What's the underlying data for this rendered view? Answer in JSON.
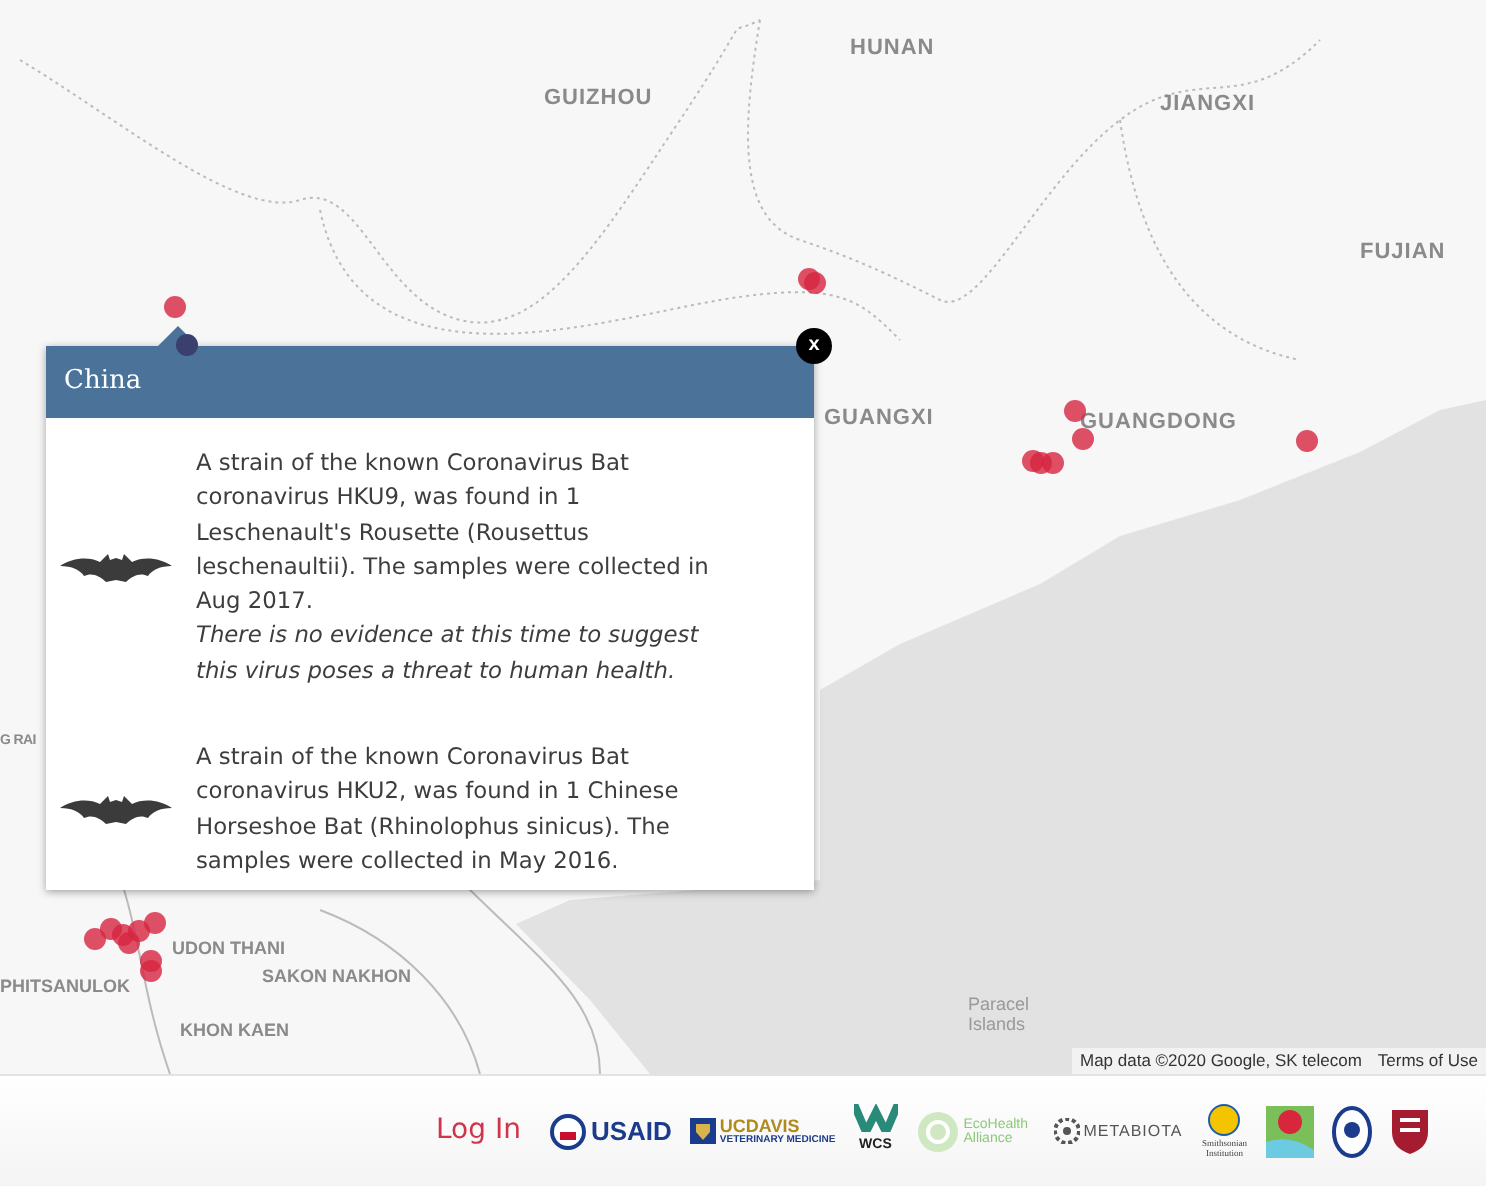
{
  "map": {
    "region_labels": [
      "HUNAN",
      "GUIZHOU",
      "JIANGXI",
      "FUJIAN",
      "GUANGXI",
      "GUANGDONG",
      "G RAI",
      "UDON THANI",
      "SAKON NAKHON",
      "PHITSANULOK",
      "KHON KAEN",
      "Paracel Islands"
    ],
    "attribution": "Map data ©2020 Google, SK telecom",
    "terms_link": "Terms of Use"
  },
  "popup": {
    "title": "China",
    "close": "x",
    "findings": [
      {
        "text": "A strain of the known Coronavirus Bat coronavirus HKU9, was found in 1 Leschenault's Rousette (Rousettus leschenaultii). The samples were collected in Aug 2017.",
        "note": "There is no evidence at this time to suggest this virus poses a threat to human health."
      },
      {
        "text": "A strain of the known Coronavirus Bat coronavirus HKU2, was found in 1 Chinese Horseshoe Bat (Rhinolophus sinicus). The samples were collected in May 2016."
      }
    ]
  },
  "footer": {
    "login": "Log In",
    "partner_logos": [
      {
        "kind": "usaid",
        "labels": [
          "USAID"
        ]
      },
      {
        "kind": "ucdavis",
        "labels": [
          "UCDAVIS",
          "VETERINARY MEDICINE"
        ]
      },
      {
        "kind": "wcs",
        "labels": [
          "WCS"
        ]
      },
      {
        "kind": "ecohealth",
        "labels": [
          "EcoHealth Alliance"
        ]
      },
      {
        "kind": "metabiota",
        "labels": [
          "METABIOTA"
        ]
      },
      {
        "kind": "smithsonian",
        "labels": [
          "Smithsonian Institution"
        ]
      },
      {
        "kind": "map-pin"
      },
      {
        "kind": "shield-oval"
      },
      {
        "kind": "shield"
      }
    ]
  }
}
